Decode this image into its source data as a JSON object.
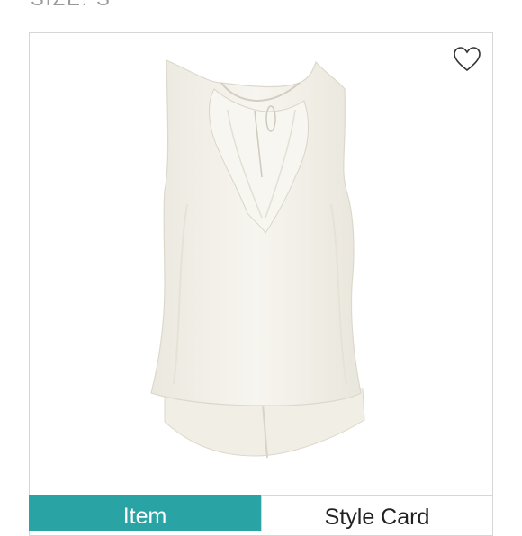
{
  "header": {
    "size_label": "SIZE: S"
  },
  "product": {
    "image_icon": "sleeveless-blouse-image",
    "favorite_icon": "heart-outline-icon"
  },
  "tabs": [
    {
      "label": "Item",
      "active": true
    },
    {
      "label": "Style Card",
      "active": false
    }
  ],
  "colors": {
    "accent": "#2aa3a5",
    "card_border": "#d6d6d6",
    "garment": "#f3f1ea"
  }
}
